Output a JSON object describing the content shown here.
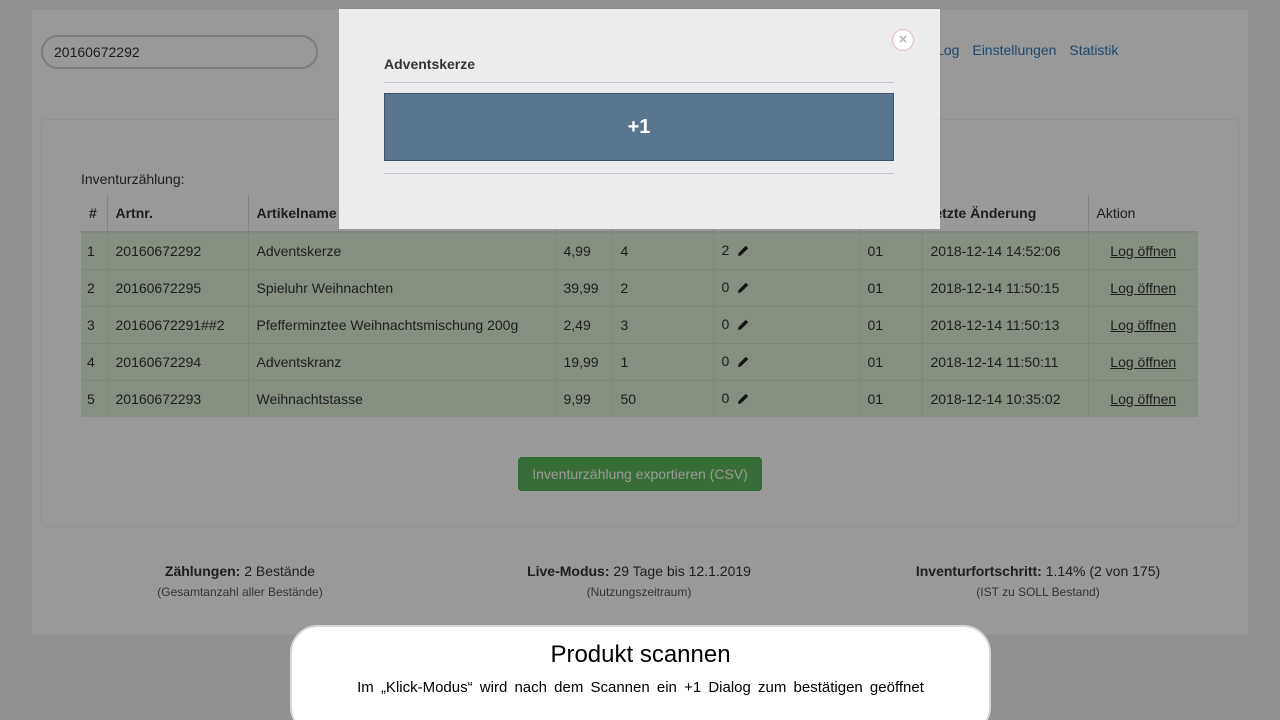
{
  "header": {
    "search_value": "20160672292",
    "nav": [
      "Log",
      "Einstellungen",
      "Statistik"
    ]
  },
  "inventory": {
    "caption": "Inventurzählung:",
    "columns": [
      "#",
      "Artnr.",
      "Artikelname",
      "",
      "",
      "",
      "",
      "letzte Änderung",
      "Aktion"
    ],
    "rows": [
      {
        "idx": "1",
        "artnr": "20160672292",
        "name": "Adventskerze",
        "price": "4,99",
        "soll": "4",
        "ist": "2",
        "lager": "01",
        "changed": "2018-12-14 14:52:06",
        "action": "Log öffnen"
      },
      {
        "idx": "2",
        "artnr": "20160672295",
        "name": "Spieluhr Weihnachten",
        "price": "39,99",
        "soll": "2",
        "ist": "0",
        "lager": "01",
        "changed": "2018-12-14 11:50:15",
        "action": "Log öffnen"
      },
      {
        "idx": "3",
        "artnr": "20160672291##2",
        "name": "Pfefferminztee Weihnachtsmischung 200g",
        "price": "2,49",
        "soll": "3",
        "ist": "0",
        "lager": "01",
        "changed": "2018-12-14 11:50:13",
        "action": "Log öffnen"
      },
      {
        "idx": "4",
        "artnr": "20160672294",
        "name": "Adventskranz",
        "price": "19,99",
        "soll": "1",
        "ist": "0",
        "lager": "01",
        "changed": "2018-12-14 11:50:11",
        "action": "Log öffnen"
      },
      {
        "idx": "5",
        "artnr": "20160672293",
        "name": "Weihnachtstasse",
        "price": "9,99",
        "soll": "50",
        "ist": "0",
        "lager": "01",
        "changed": "2018-12-14 10:35:02",
        "action": "Log öffnen"
      }
    ],
    "export_label": "Inventurzählung exportieren (CSV)"
  },
  "stats": {
    "counts": {
      "label": "Zählungen:",
      "value": "2 Bestände",
      "sub": "(Gesamtanzahl aller Bestände)"
    },
    "live": {
      "label": "Live-Modus:",
      "value": "29 Tage bis 12.1.2019",
      "sub": "(Nutzungszeitraum)"
    },
    "progress": {
      "label": "Inventurfortschritt:",
      "value": "1.14% (2 von 175)",
      "sub": "(IST zu SOLL Bestand)"
    }
  },
  "modal": {
    "title": "Adventskerze",
    "button_label": "+1",
    "close_symbol": "×"
  },
  "callout": {
    "title": "Produkt scannen",
    "text": "Im „Klick-Modus“ wird nach dem Scannen ein +1 Dialog zum bestätigen geöffnet"
  },
  "colors": {
    "row_bg": "#dff0d8",
    "link": "#337ab7",
    "export_button": "#5cb85c",
    "plus_one_button": "#5a7590"
  },
  "icons": {
    "edit": "pencil-icon",
    "close": "close-icon"
  }
}
